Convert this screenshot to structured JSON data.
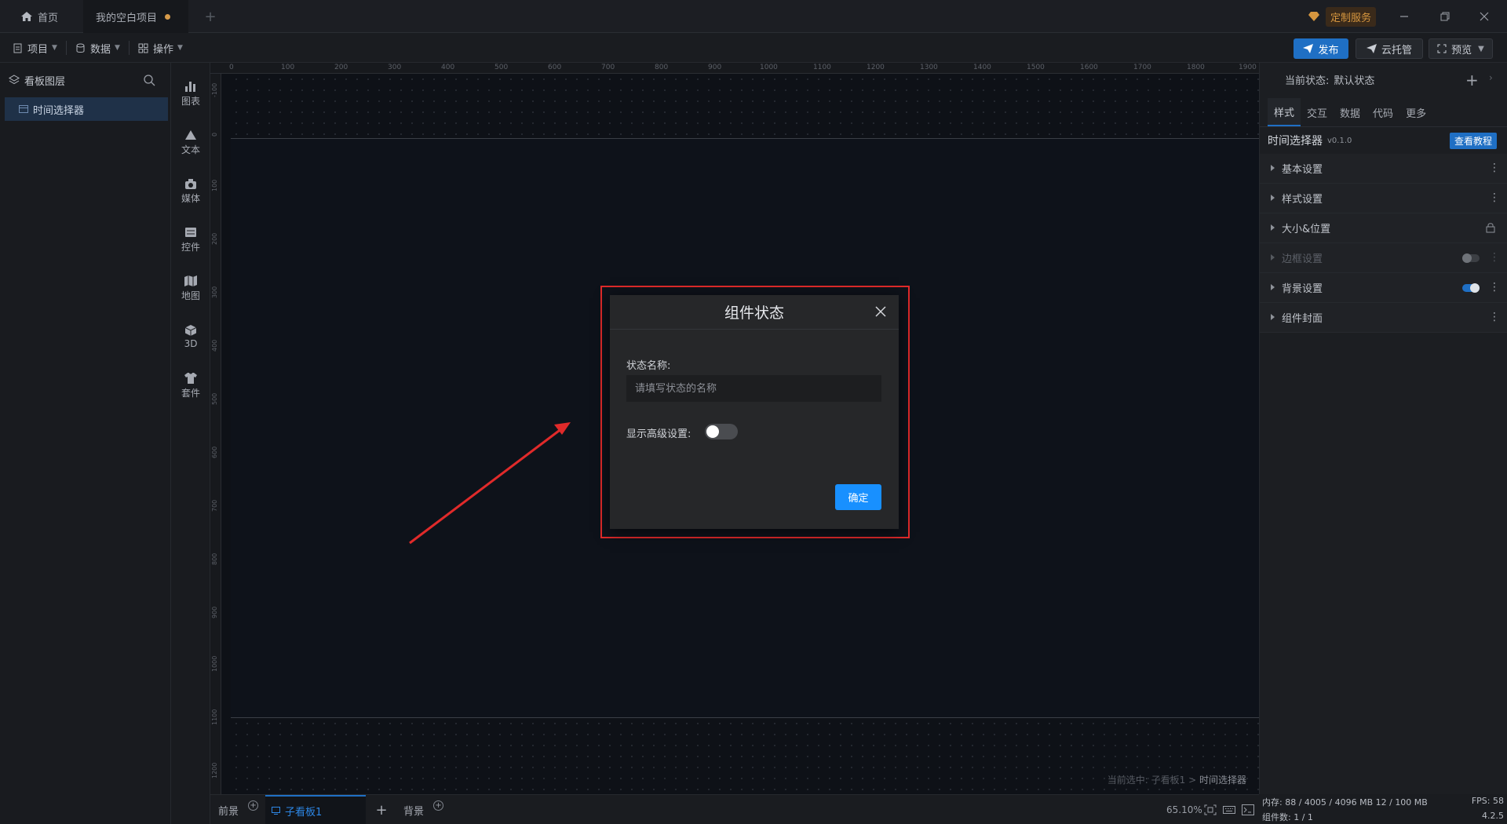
{
  "colors": {
    "accent": "#1f6fc4",
    "primary_button": "#1890ff",
    "highlight_border": "#e02a2a",
    "unsaved_dot": "#d79b4a",
    "custom_service": "#d6963f"
  },
  "titlebar": {
    "tabs": [
      {
        "label": "首页",
        "icon": "home-icon"
      },
      {
        "label": "我的空白项目",
        "unsaved": true
      }
    ],
    "custom_service_label": "定制服务"
  },
  "menubar": {
    "items": [
      {
        "label": "项目",
        "icon": "document-icon"
      },
      {
        "label": "数据",
        "icon": "database-icon"
      },
      {
        "label": "操作",
        "icon": "grid-icon"
      }
    ],
    "publish_label": "发布",
    "cloud_label": "云托管",
    "preview_label": "预览"
  },
  "layers": {
    "title": "看板图层",
    "items": [
      {
        "label": "时间选择器"
      }
    ]
  },
  "rail": {
    "items": [
      {
        "label": "图表",
        "icon": "chart-icon"
      },
      {
        "label": "文本",
        "icon": "text-icon"
      },
      {
        "label": "媒体",
        "icon": "media-icon"
      },
      {
        "label": "控件",
        "icon": "control-icon"
      },
      {
        "label": "地图",
        "icon": "map-icon"
      },
      {
        "label": "3D",
        "icon": "cube-icon"
      },
      {
        "label": "套件",
        "icon": "kit-icon"
      }
    ]
  },
  "canvas": {
    "ruler_top": [
      "0",
      "100",
      "200",
      "300",
      "400",
      "500",
      "600",
      "700",
      "800",
      "900",
      "1000",
      "1100",
      "1200",
      "1300",
      "1400",
      "1500",
      "1600",
      "1700",
      "1800",
      "1900"
    ],
    "ruler_left": [
      "-100",
      "0",
      "100",
      "200",
      "300",
      "400",
      "500",
      "600",
      "700",
      "800",
      "900",
      "1000",
      "1100",
      "1200"
    ],
    "selection_prefix": "当前选中: 子看板1 > ",
    "selection_target": "时间选择器"
  },
  "bottom": {
    "tabs": [
      {
        "label": "前景"
      },
      {
        "label": "子看板1",
        "active": true
      },
      {
        "label": "背景"
      }
    ],
    "add_label": "+",
    "zoom": "65.10%"
  },
  "props": {
    "state_label": "当前状态:",
    "state_value": "默认状态",
    "tabs": [
      {
        "label": "样式",
        "active": true
      },
      {
        "label": "交互"
      },
      {
        "label": "数据"
      },
      {
        "label": "代码"
      },
      {
        "label": "更多"
      }
    ],
    "component_name": "时间选择器",
    "component_version": "v0.1.0",
    "tutorial_label": "查看教程",
    "sections": [
      {
        "label": "基本设置"
      },
      {
        "label": "样式设置"
      },
      {
        "label": "大小&位置"
      },
      {
        "label": "边框设置",
        "enabled": false
      },
      {
        "label": "背景设置",
        "enabled": true
      },
      {
        "label": "组件封面"
      }
    ]
  },
  "statusbar": {
    "memory": "内存: 88 / 4005 / 4096 MB  12 / 100 MB",
    "component_count": "组件数: 1 / 1",
    "fps": "FPS:  58",
    "version": "4.2.5"
  },
  "modal": {
    "title": "组件状态",
    "name_label": "状态名称:",
    "name_placeholder": "请填写状态的名称",
    "name_value": "",
    "advanced_label": "显示高级设置:",
    "advanced_enabled": false,
    "confirm_label": "确定"
  }
}
